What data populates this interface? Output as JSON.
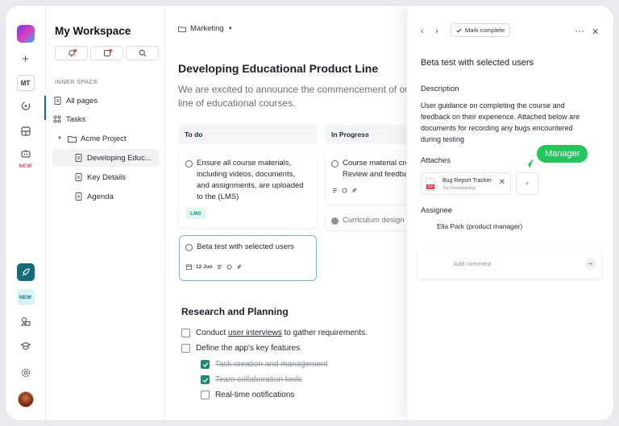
{
  "rail": {
    "mt_label": "MT",
    "new_label_1": "NEW",
    "new_label_2": "NEW"
  },
  "sidebar": {
    "title": "My Workspace",
    "section_label": "INNER SPACE",
    "items": [
      {
        "label": "All pages"
      },
      {
        "label": "Tasks"
      },
      {
        "label": "Acme Project"
      },
      {
        "label": "Developing Educ..."
      },
      {
        "label": "Key Details"
      },
      {
        "label": "Agenda"
      }
    ]
  },
  "main": {
    "breadcrumb": "Marketing",
    "title": "Developing Educational Product Line",
    "intro": "We are excited to announce the commencement of our comprehensive product line of educational courses.",
    "columns": [
      {
        "label": "To do"
      },
      {
        "label": "In Progress"
      }
    ],
    "cards": [
      {
        "text": "Ensure all course materials, including videos, documents, and assignments, are uploaded to the (LMS)",
        "tag": "LMS"
      },
      {
        "text": "Beta test with selected users",
        "date": "12 Jun"
      },
      {
        "text": "Course material creation Review and feedback"
      },
      {
        "text": "Curriculum design"
      }
    ],
    "section_title": "Research and Planning",
    "checklist": [
      {
        "prefix": "Conduct ",
        "link": "user interviews",
        "suffix": " to gather requirements.",
        "checked": false
      },
      {
        "text": "Define the app's key features",
        "checked": false
      },
      {
        "text": "Task creation and management",
        "checked": true
      },
      {
        "text": "Team collaboration tools",
        "checked": true
      },
      {
        "text": "Real-time notifications",
        "checked": false
      }
    ]
  },
  "panel": {
    "mark_complete": "Mark complete",
    "title": "Beta test with selected users",
    "description_label": "Description",
    "description": "User guidance on completing the course and feedback on their experience. Attached below are documents for recording any bugs encountered during testing",
    "attaches_label": "Attaches",
    "attachment": {
      "name": "Bug Report Tracker",
      "sub": "Zip Downloading",
      "type": "ZIP"
    },
    "badge": "Manager",
    "assignee_label": "Assignee",
    "assignee": "Ella Park (product manager)",
    "comment_placeholder": "Add comment"
  },
  "colors": {
    "accent": "#136b7a",
    "check": "#1b8b7a",
    "badge": "#22c55e",
    "danger": "#e5484d"
  }
}
